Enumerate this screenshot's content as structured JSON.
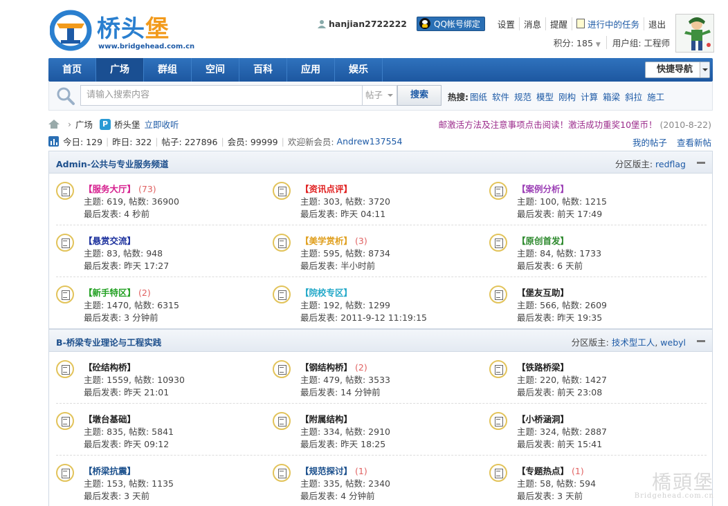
{
  "header": {
    "logo_cn_a": "桥头",
    "logo_cn_b": "堡",
    "logo_url": "www.bridgehead.com.cn",
    "username": "hanjian2722222",
    "qq_bind": "QQ帐号绑定",
    "links": [
      "设置",
      "消息",
      "提醒"
    ],
    "task": "进行中的任务",
    "logout": "退出",
    "credit": "积分: 185",
    "usergroup": "用户组: 工程师"
  },
  "nav": {
    "items": [
      "首页",
      "广场",
      "群组",
      "空间",
      "百科",
      "应用",
      "娱乐"
    ],
    "active": 1,
    "quick_label": "快捷导航"
  },
  "search": {
    "placeholder": "请输入搜索内容",
    "type": "帖子",
    "button": "搜索",
    "hot_label": "热搜:",
    "hot": [
      "图纸",
      "软件",
      "规范",
      "模型",
      "刚构",
      "计算",
      "箱梁",
      "斜拉",
      "施工"
    ]
  },
  "crumb": {
    "current": "广场",
    "site": "桥头堡",
    "fav": "立即收听",
    "pi_glyph": "P",
    "notice": "邮激活方法及注意事项点击阅读！激活成功重奖10堡币！",
    "notice_date": "(2010-8-22)"
  },
  "stats": {
    "today": "今日: 129",
    "yesterday": "昨日: 322",
    "posts": "帖子: 227896",
    "members": "会员: 99999",
    "welcome": "欢迎新会员:",
    "newest": "Andrew137554",
    "my_posts": "我的帖子",
    "new_posts": "查看新帖"
  },
  "sections": [
    {
      "title": "Admin-公共与专业服务频道",
      "mod_label": "分区版主:",
      "mods": [
        "redflag"
      ],
      "forums": [
        {
          "name": "【服务大厅】",
          "color": "#d6208f",
          "count": "(73)",
          "topics": "主题: 619, 帖数: 36900",
          "last": "最后发表: 4 秒前"
        },
        {
          "name": "【资讯点评】",
          "color": "#e02020",
          "count": "",
          "topics": "主题: 303, 帖数: 3720",
          "last": "最后发表: 昨天 04:11"
        },
        {
          "name": "【案例分析】",
          "color": "#9b3fb5",
          "count": "",
          "topics": "主题: 100, 帖数: 1215",
          "last": "最后发表: 前天 17:49"
        },
        {
          "name": "【悬赏交流】",
          "color": "#1a2f9c",
          "count": "",
          "topics": "主题: 83, 帖数: 948",
          "last": "最后发表: 昨天 17:27"
        },
        {
          "name": "【美学赏析】",
          "color": "#e0a020",
          "count": "(3)",
          "topics": "主题: 595, 帖数: 8734",
          "last": "最后发表: 半小时前"
        },
        {
          "name": "【原创首发】",
          "color": "#2e8a2e",
          "count": "",
          "topics": "主题: 84, 帖数: 1733",
          "last": "最后发表: 6 天前"
        },
        {
          "name": "【新手特区】",
          "color": "#22a022",
          "count": "(2)",
          "topics": "主题: 1470, 帖数: 6315",
          "last": "最后发表: 3 分钟前"
        },
        {
          "name": "【院校专区】",
          "color": "#22a8c8",
          "count": "",
          "topics": "主题: 192, 帖数: 1299",
          "last": "最后发表: 2011-9-12 11:19:15"
        },
        {
          "name": "【堡友互助】",
          "color": "#222222",
          "count": "",
          "topics": "主题: 566, 帖数: 2609",
          "last": "最后发表: 昨天 19:35"
        }
      ]
    },
    {
      "title": "B-桥梁专业理论与工程实践",
      "mod_label": "分区版主:",
      "mods": [
        "技术型工人",
        "webyl"
      ],
      "forums": [
        {
          "name": "【砼结构桥】",
          "color": "#222222",
          "count": "",
          "topics": "主题: 1559, 帖数: 10930",
          "last": "最后发表: 昨天 21:01"
        },
        {
          "name": "【钢结构桥】",
          "color": "#222222",
          "count": "(2)",
          "topics": "主题: 479, 帖数: 3533",
          "last": "最后发表: 14 分钟前"
        },
        {
          "name": "【铁路桥梁】",
          "color": "#222222",
          "count": "",
          "topics": "主题: 220, 帖数: 1427",
          "last": "最后发表: 前天 23:08"
        },
        {
          "name": "【墩台基础】",
          "color": "#222222",
          "count": "",
          "topics": "主题: 835, 帖数: 5841",
          "last": "最后发表: 昨天 09:12"
        },
        {
          "name": "【附属结构】",
          "color": "#222222",
          "count": "",
          "topics": "主题: 334, 帖数: 2910",
          "last": "最后发表: 昨天 18:25"
        },
        {
          "name": "【小桥涵洞】",
          "color": "#222222",
          "count": "",
          "topics": "主题: 324, 帖数: 2887",
          "last": "最后发表: 前天 15:41"
        },
        {
          "name": "【桥梁抗震】",
          "color": "#1a4f8c",
          "count": "",
          "topics": "主题: 153, 帖数: 1135",
          "last": "最后发表: 3 天前"
        },
        {
          "name": "【规范探讨】",
          "color": "#1a4f8c",
          "count": "(1)",
          "topics": "主题: 335, 帖数: 2340",
          "last": "最后发表: 4 分钟前"
        },
        {
          "name": "【专题热点】",
          "color": "#222222",
          "count": "(1)",
          "topics": "主题: 58, 帖数: 594",
          "last": "最后发表: 3 天前"
        }
      ]
    }
  ],
  "watermark": {
    "cn": "橋頭堡",
    "en": "Bridgehead.com.cn"
  }
}
